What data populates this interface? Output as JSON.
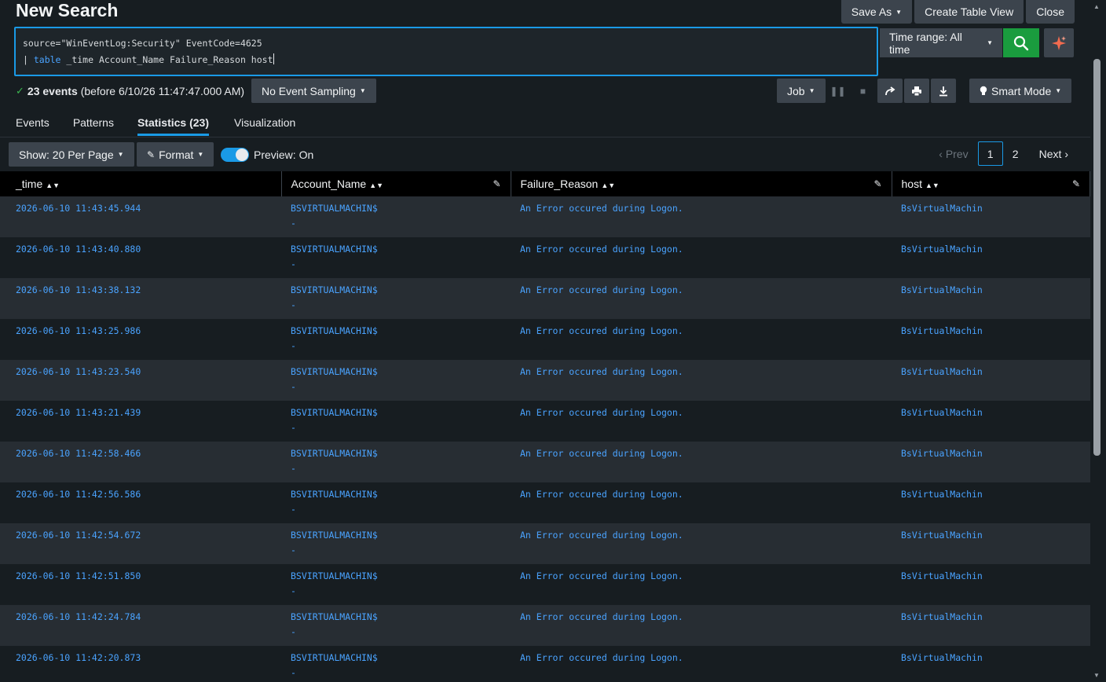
{
  "page": {
    "title": "New Search"
  },
  "top_actions": {
    "save_as": "Save As",
    "create_table_view": "Create Table View",
    "close": "Close"
  },
  "search": {
    "line1": "source=\"WinEventLog:Security\" EventCode=4625",
    "line2_pipe": "| ",
    "line2_cmd": "table",
    "line2_rest": " _time Account_Name Failure_Reason host",
    "time_range": "Time range: All time"
  },
  "status": {
    "count": "23 events",
    "detail": "(before 6/10/26 11:47:47.000 AM)",
    "sampling": "No Event Sampling"
  },
  "job": {
    "label": "Job",
    "smart_mode": "Smart Mode"
  },
  "tabs": [
    {
      "label": "Events"
    },
    {
      "label": "Patterns"
    },
    {
      "label": "Statistics (23)"
    },
    {
      "label": "Visualization"
    }
  ],
  "controls": {
    "show": "Show: 20 Per Page",
    "format": "Format",
    "preview": "Preview: On"
  },
  "pager": {
    "prev": "Prev",
    "pages": [
      "1",
      "2"
    ],
    "next": "Next"
  },
  "table": {
    "headers": [
      "_time",
      "Account_Name",
      "Failure_Reason",
      "host"
    ],
    "rows": [
      {
        "time": "2026-06-10 11:43:45.944",
        "account": "BSVIRTUALMACHIN$",
        "dash": "-",
        "reason": "An Error occured during Logon.",
        "host": "BsVirtualMachin"
      },
      {
        "time": "2026-06-10 11:43:40.880",
        "account": "BSVIRTUALMACHIN$",
        "dash": "-",
        "reason": "An Error occured during Logon.",
        "host": "BsVirtualMachin"
      },
      {
        "time": "2026-06-10 11:43:38.132",
        "account": "BSVIRTUALMACHIN$",
        "dash": "-",
        "reason": "An Error occured during Logon.",
        "host": "BsVirtualMachin"
      },
      {
        "time": "2026-06-10 11:43:25.986",
        "account": "BSVIRTUALMACHIN$",
        "dash": "-",
        "reason": "An Error occured during Logon.",
        "host": "BsVirtualMachin"
      },
      {
        "time": "2026-06-10 11:43:23.540",
        "account": "BSVIRTUALMACHIN$",
        "dash": "-",
        "reason": "An Error occured during Logon.",
        "host": "BsVirtualMachin"
      },
      {
        "time": "2026-06-10 11:43:21.439",
        "account": "BSVIRTUALMACHIN$",
        "dash": "-",
        "reason": "An Error occured during Logon.",
        "host": "BsVirtualMachin"
      },
      {
        "time": "2026-06-10 11:42:58.466",
        "account": "BSVIRTUALMACHIN$",
        "dash": "-",
        "reason": "An Error occured during Logon.",
        "host": "BsVirtualMachin"
      },
      {
        "time": "2026-06-10 11:42:56.586",
        "account": "BSVIRTUALMACHIN$",
        "dash": "-",
        "reason": "An Error occured during Logon.",
        "host": "BsVirtualMachin"
      },
      {
        "time": "2026-06-10 11:42:54.672",
        "account": "BSVIRTUALMACHIN$",
        "dash": "-",
        "reason": "An Error occured during Logon.",
        "host": "BsVirtualMachin"
      },
      {
        "time": "2026-06-10 11:42:51.850",
        "account": "BSVIRTUALMACHIN$",
        "dash": "-",
        "reason": "An Error occured during Logon.",
        "host": "BsVirtualMachin"
      },
      {
        "time": "2026-06-10 11:42:24.784",
        "account": "BSVIRTUALMACHIN$",
        "dash": "-",
        "reason": "An Error occured during Logon.",
        "host": "BsVirtualMachin"
      },
      {
        "time": "2026-06-10 11:42:20.873",
        "account": "BSVIRTUALMACHIN$",
        "dash": "-",
        "reason": "An Error occured during Logon.",
        "host": "BsVirtualMachin"
      }
    ]
  },
  "colors": {
    "accent": "#1a9ae6",
    "search_button": "#1a9c3e",
    "link": "#4aa3ff"
  }
}
